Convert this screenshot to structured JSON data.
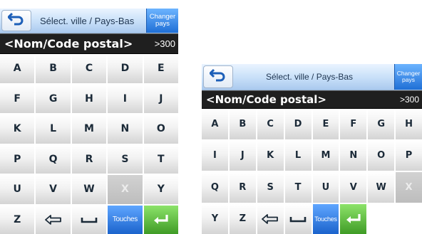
{
  "screens": [
    {
      "title": "Sélect. ville / Pays-Bas",
      "change_country": [
        "Changer",
        "pays"
      ],
      "input": {
        "value": "<Nom/Code postal>",
        "count": ">300"
      },
      "keys": [
        {
          "label": "A"
        },
        {
          "label": "B"
        },
        {
          "label": "C"
        },
        {
          "label": "D"
        },
        {
          "label": "E"
        },
        {
          "label": "F"
        },
        {
          "label": "G"
        },
        {
          "label": "H"
        },
        {
          "label": "I"
        },
        {
          "label": "J"
        },
        {
          "label": "K"
        },
        {
          "label": "L"
        },
        {
          "label": "M"
        },
        {
          "label": "N"
        },
        {
          "label": "O"
        },
        {
          "label": "P"
        },
        {
          "label": "Q"
        },
        {
          "label": "R"
        },
        {
          "label": "S"
        },
        {
          "label": "T"
        },
        {
          "label": "U"
        },
        {
          "label": "V"
        },
        {
          "label": "W"
        },
        {
          "label": "X",
          "disabled": true
        },
        {
          "label": "Y"
        },
        {
          "label": "Z"
        },
        {
          "icon": "backspace-arrow-icon"
        },
        {
          "icon": "space-bar-icon"
        },
        {
          "label": "Touches",
          "kind": "touches"
        },
        {
          "icon": "enter-arrow-icon",
          "kind": "enter"
        }
      ]
    },
    {
      "title": "Sélect. ville / Pays-Bas",
      "change_country": [
        "Changer",
        "pays"
      ],
      "input": {
        "value": "<Nom/Code postal>",
        "count": ">300"
      },
      "keys": [
        {
          "label": "A"
        },
        {
          "label": "B"
        },
        {
          "label": "C"
        },
        {
          "label": "D"
        },
        {
          "label": "E"
        },
        {
          "label": "F"
        },
        {
          "label": "G"
        },
        {
          "label": "H"
        },
        {
          "label": "I"
        },
        {
          "label": "J"
        },
        {
          "label": "K"
        },
        {
          "label": "L"
        },
        {
          "label": "M"
        },
        {
          "label": "N"
        },
        {
          "label": "O"
        },
        {
          "label": "P"
        },
        {
          "label": "Q"
        },
        {
          "label": "R"
        },
        {
          "label": "S"
        },
        {
          "label": "T"
        },
        {
          "label": "U"
        },
        {
          "label": "V"
        },
        {
          "label": "W"
        },
        {
          "label": "X",
          "disabled": true
        },
        {
          "label": "Y"
        },
        {
          "label": "Z"
        },
        {
          "icon": "backspace-arrow-icon"
        },
        {
          "icon": "space-bar-icon"
        },
        {
          "label": "Touches",
          "kind": "touches"
        },
        {
          "icon": "enter-arrow-icon",
          "kind": "enter"
        }
      ]
    }
  ],
  "colors": {
    "title_gradient_top": "#eaf4ff",
    "title_gradient_bottom": "#aac9ee",
    "accent_blue": "#1f6fd6",
    "enter_green": "#3f9b26",
    "input_bar": "#1f1f1f",
    "key_text": "#1b2a38"
  }
}
